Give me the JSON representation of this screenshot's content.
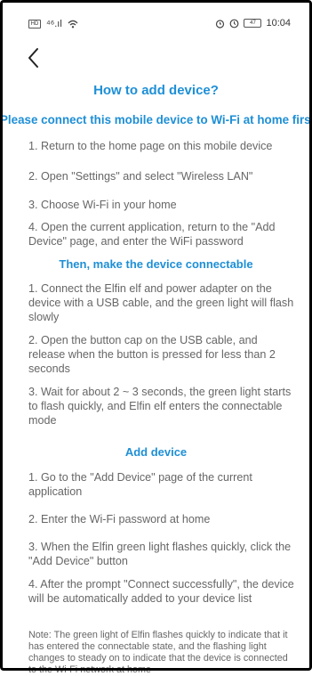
{
  "status_bar": {
    "left_icons": [
      "sim-icon",
      "signal-icon",
      "wifi-icon"
    ],
    "signal_text": "⁴⁶.ıl",
    "time": "10:04",
    "battery": "47"
  },
  "header": {
    "back_icon": "chevron-left-icon",
    "title": "How to add device?"
  },
  "section1": {
    "heading": "Please connect this mobile device to Wi-Fi at home first",
    "steps": [
      "1. Return to the home page on this mobile device",
      "2. Open \"Settings\" and select \"Wireless LAN\"",
      "3. Choose Wi-Fi in your home",
      "4. Open the current application, return to the \"Add Device\" page, and enter the WiFi password"
    ]
  },
  "section2": {
    "heading": "Then, make the device connectable",
    "steps": [
      "1. Connect the Elfin elf and power adapter on the device with a USB cable, and the green light will flash slowly",
      "2. Open the button cap on the USB cable, and release when the button is pressed for less than 2 seconds",
      "3. Wait for about 2 ~ 3 seconds, the green light starts to flash quickly, and Elfin elf enters the connectable mode"
    ]
  },
  "section3": {
    "heading": "Add device",
    "steps": [
      "1. Go to the \"Add Device\" page of the current application",
      "2. Enter the Wi-Fi password at home",
      "3. When the Elfin green light flashes quickly, click the \"Add Device\" button",
      "4. After the prompt \"Connect successfully\", the device will be automatically added to your device list"
    ],
    "note": "Note: The green light of Elfin flashes quickly to indicate that it has entered the connectable state, and the flashing light changes to steady on to indicate that the device is connected to the Wi-Fi network at home"
  },
  "colors": {
    "accent": "#1e8fd6",
    "body_text": "#666666",
    "background": "#ffffff"
  }
}
